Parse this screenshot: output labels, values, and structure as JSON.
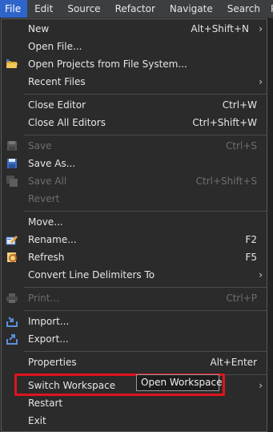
{
  "menubar": {
    "items": [
      "File",
      "Edit",
      "Source",
      "Refactor",
      "Navigate",
      "Search",
      "P"
    ]
  },
  "menu": {
    "new": {
      "label": "New",
      "accel": "Alt+Shift+N"
    },
    "open_file": {
      "label": "Open File..."
    },
    "open_projects": {
      "label": "Open Projects from File System..."
    },
    "recent_files": {
      "label": "Recent Files"
    },
    "close_editor": {
      "label": "Close Editor",
      "accel": "Ctrl+W"
    },
    "close_all_editors": {
      "label": "Close All Editors",
      "accel": "Ctrl+Shift+W"
    },
    "save": {
      "label": "Save",
      "accel": "Ctrl+S"
    },
    "save_as": {
      "label": "Save As..."
    },
    "save_all": {
      "label": "Save All",
      "accel": "Ctrl+Shift+S"
    },
    "revert": {
      "label": "Revert"
    },
    "move": {
      "label": "Move..."
    },
    "rename": {
      "label": "Rename...",
      "accel": "F2"
    },
    "refresh": {
      "label": "Refresh",
      "accel": "F5"
    },
    "convert_line_delimiters": {
      "label": "Convert Line Delimiters To"
    },
    "print": {
      "label": "Print...",
      "accel": "Ctrl+P"
    },
    "import": {
      "label": "Import..."
    },
    "export": {
      "label": "Export..."
    },
    "properties": {
      "label": "Properties",
      "accel": "Alt+Enter"
    },
    "switch_workspace": {
      "label": "Switch Workspace"
    },
    "restart": {
      "label": "Restart"
    },
    "exit": {
      "label": "Exit"
    }
  },
  "tooltip": {
    "text": "Open Workspace"
  },
  "colors": {
    "accent": "#2f65ca",
    "highlight_box": "#e0141e",
    "menu_bg": "#2b2b2b"
  }
}
